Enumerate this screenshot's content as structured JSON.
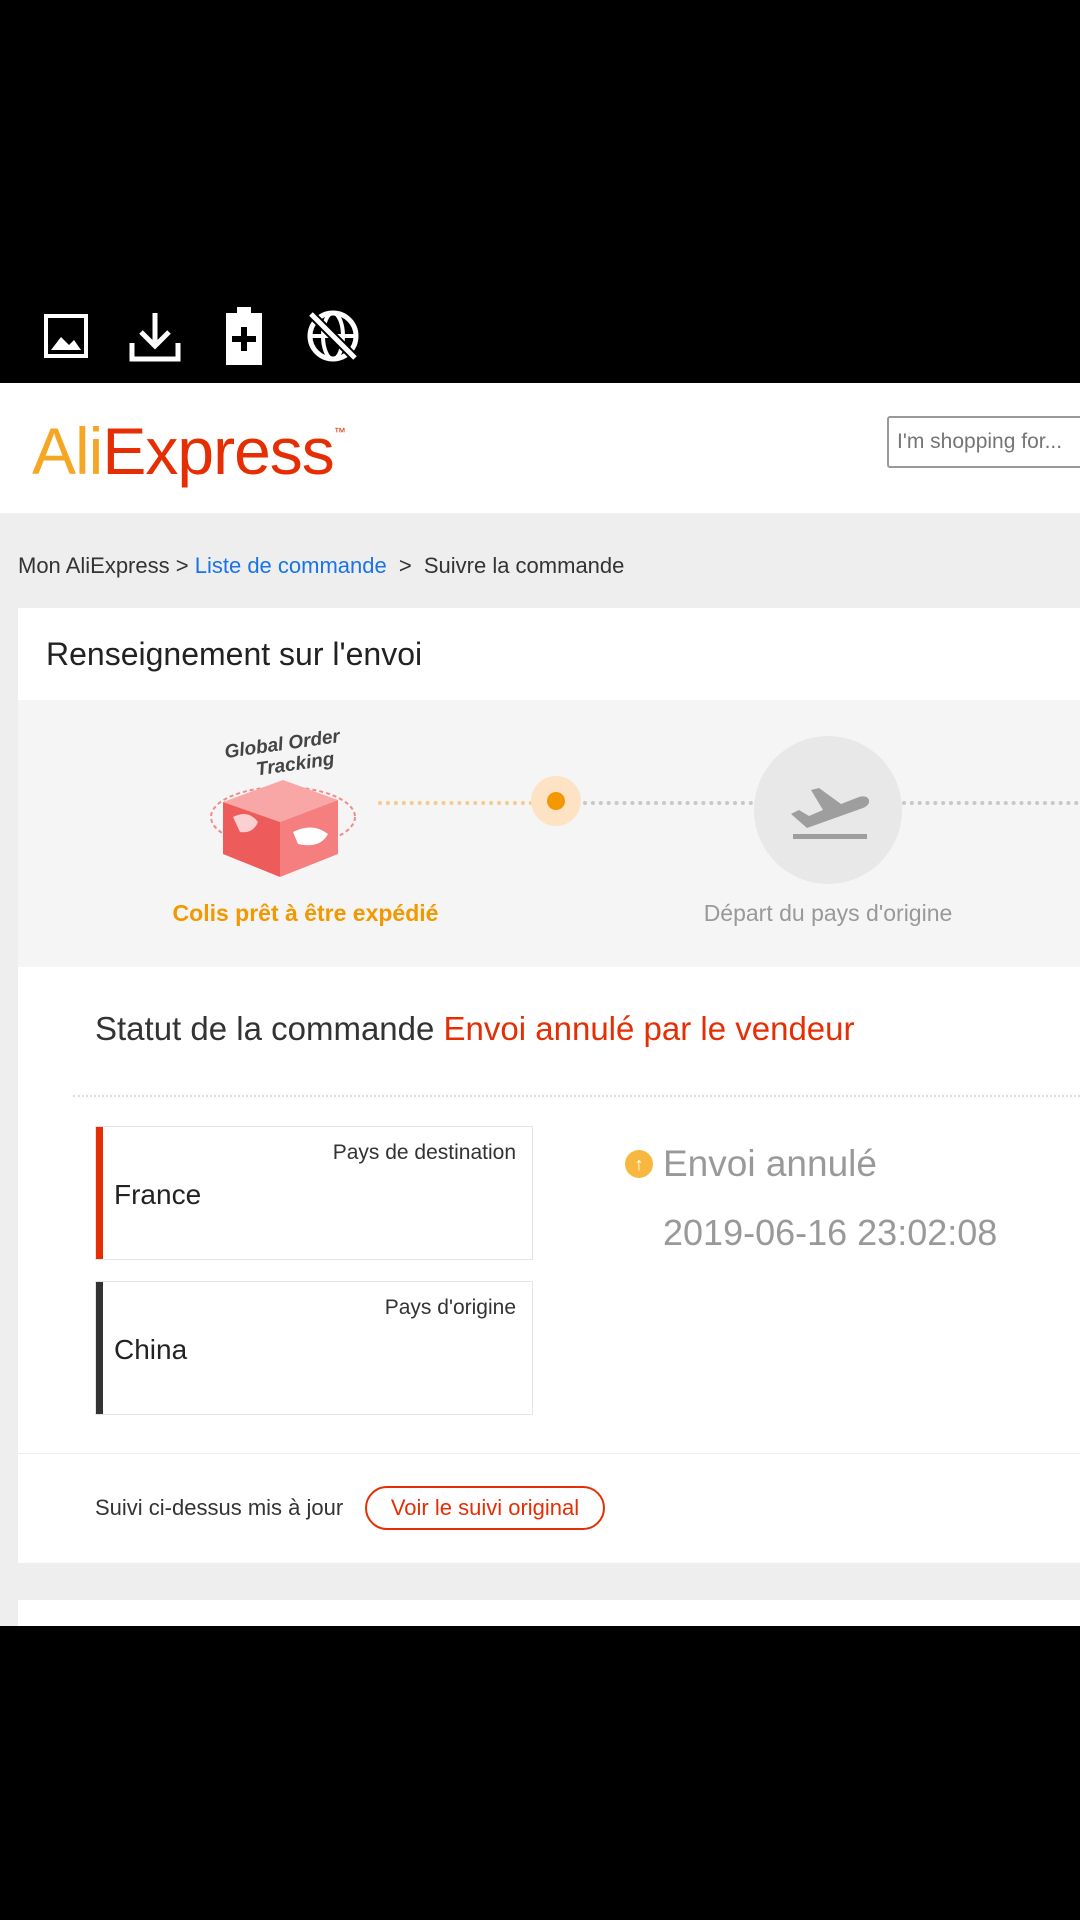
{
  "toolbar": {
    "icons": [
      "image-icon",
      "download-icon",
      "battery-plus-icon",
      "no-web-icon"
    ]
  },
  "header": {
    "logo_part1": "Ali",
    "logo_part2": "Express",
    "logo_tm": "™",
    "search_placeholder": "I'm shopping for..."
  },
  "breadcrumb": {
    "home": "Mon AliExpress",
    "sep1": ">",
    "orders_link": "Liste de commande",
    "sep2": ">",
    "current": "Suivre la commande"
  },
  "shipping": {
    "title": "Renseignement sur l'envoi",
    "tracking_badge": "Global Order Tracking",
    "steps": [
      {
        "label": "Colis prêt à être expédié",
        "state": "active"
      },
      {
        "label": "Départ du pays d'origine",
        "state": "pending"
      }
    ],
    "status_label": "Statut de la commande",
    "status_value": "Envoi annulé par le vendeur",
    "destination": {
      "caption": "Pays de destination",
      "country": "France"
    },
    "origin": {
      "caption": "Pays d'origine",
      "country": "China"
    },
    "event": {
      "title": "Envoi annulé",
      "date": "2019-06-16 23:02:08"
    },
    "footer_text": "Suivi ci-dessus mis à jour",
    "original_button": "Voir le suivi original"
  },
  "colors": {
    "orange": "#f39800",
    "red": "#e62e04",
    "link": "#1a73e8",
    "grey_text": "#999999"
  }
}
